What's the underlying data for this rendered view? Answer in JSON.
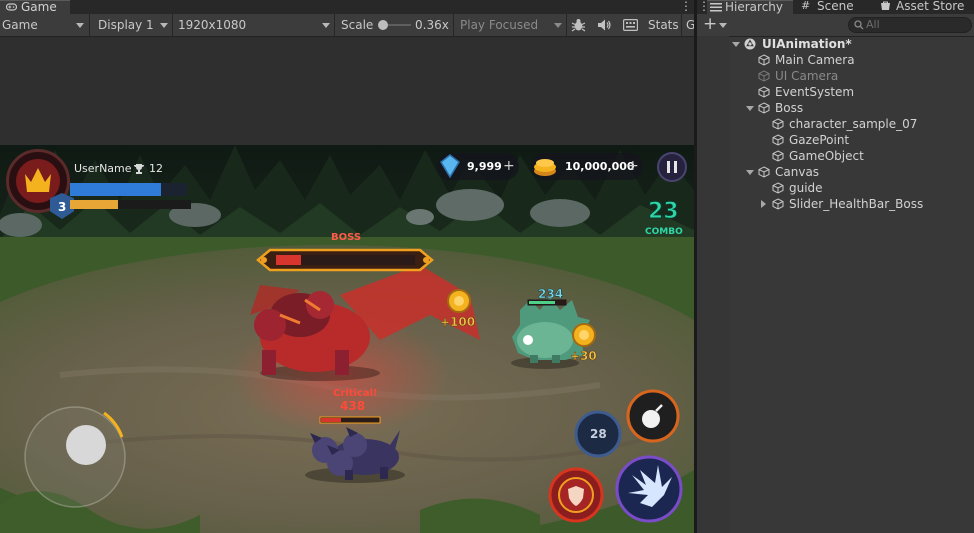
{
  "game_panel": {
    "tab_label": "Game",
    "toolbar": {
      "mode": "Game",
      "display": "Display 1",
      "resolution": "1920x1080",
      "scale_label": "Scale",
      "scale_value": "0.36x",
      "play_mode": "Play Focused",
      "stats": "Stats",
      "overflow": "G"
    }
  },
  "hud": {
    "username": "UserName",
    "trophies": "12",
    "level": "3",
    "health_fraction": 0.78,
    "exp_fraction": 0.4,
    "gems": "9,999",
    "gold": "10,000,000",
    "combo_count": "23",
    "combo_label": "COMBO",
    "boss_label": "BOSS",
    "boss_health_fraction": 0.18,
    "gold_pickup_1": "+100",
    "gold_pickup_2": "+30",
    "damage_number_1": "234",
    "critical_label": "Critical!",
    "damage_number_2": "438",
    "skill_cooldown": "28"
  },
  "hierarchy": {
    "tabs": [
      {
        "label": "Hierarchy",
        "icon": "list-icon"
      },
      {
        "label": "Scene",
        "icon": "grid-icon"
      },
      {
        "label": "Asset Store",
        "icon": "store-icon"
      }
    ],
    "search_placeholder": "All",
    "add_label": "+",
    "items": [
      {
        "label": "UIAnimation*",
        "type": "scene"
      },
      {
        "label": "Main Camera",
        "type": "gameobject"
      },
      {
        "label": "UI Camera",
        "type": "gameobject",
        "inactive": true
      },
      {
        "label": "EventSystem",
        "type": "gameobject"
      },
      {
        "label": "Boss",
        "type": "gameobject"
      },
      {
        "label": "character_sample_07",
        "type": "gameobject"
      },
      {
        "label": "GazePoint",
        "type": "gameobject"
      },
      {
        "label": "GameObject",
        "type": "gameobject"
      },
      {
        "label": "Canvas",
        "type": "gameobject"
      },
      {
        "label": "guide",
        "type": "gameobject"
      },
      {
        "label": "Slider_HealthBar_Boss",
        "type": "gameobject"
      }
    ]
  },
  "colors": {
    "editor_bg": "#383838",
    "accent_combo": "#2fd7a8",
    "boss_red": "#d8352f",
    "gold": "#f3b21e",
    "health_blue": "#2e7bd8"
  }
}
